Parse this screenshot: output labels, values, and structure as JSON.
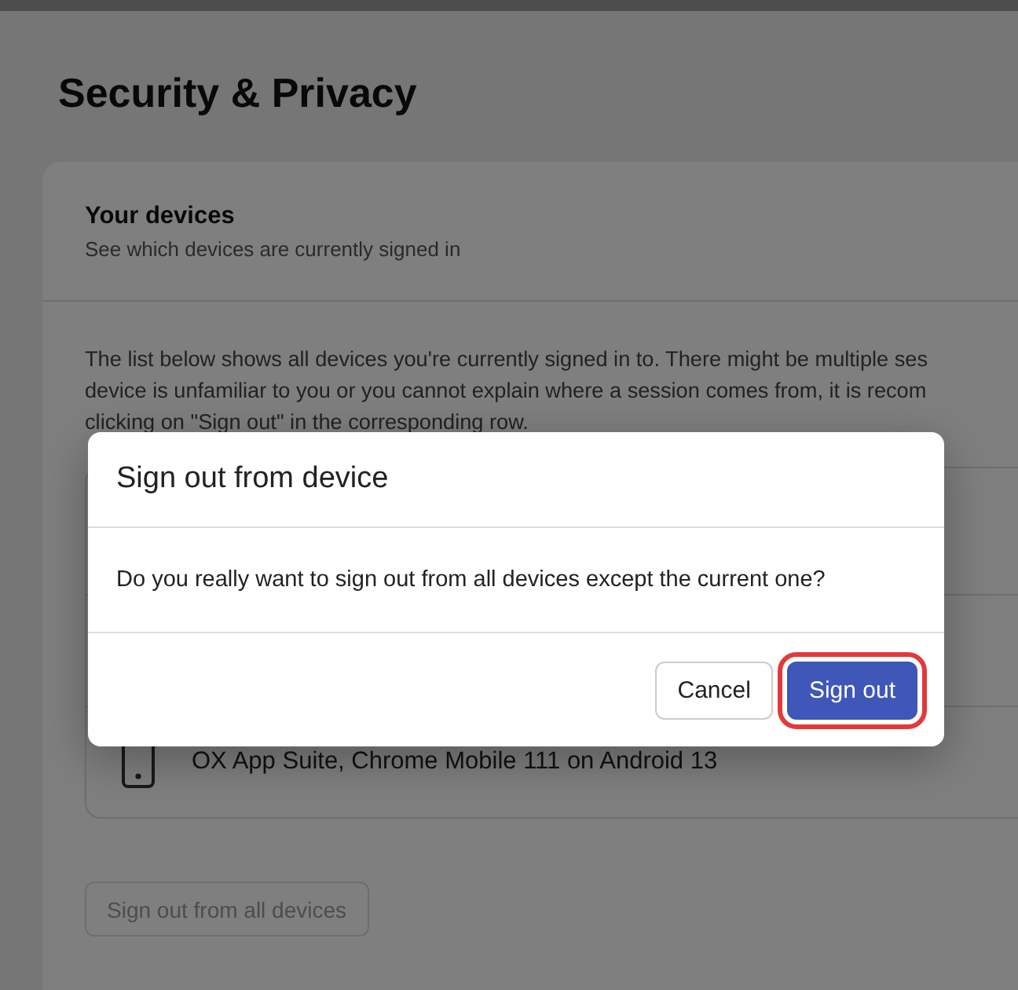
{
  "page": {
    "title": "Security & Privacy"
  },
  "devices_card": {
    "heading": "Your devices",
    "subheading": "See which devices are currently signed in",
    "description_lines": [
      "The list below shows all devices you're currently signed in to. There might be multiple ses",
      "device is unfamiliar to you or you cannot explain where a session comes from, it is recom",
      "clicking on \"Sign out\" in the corresponding row."
    ],
    "devices": [
      {
        "kind": "phone",
        "name": "OX App Suite, Chrome Mobile 111 on Android 13"
      }
    ],
    "sign_out_all_button": {
      "label": "Sign out from all devices",
      "disabled": true
    }
  },
  "dialog": {
    "title": "Sign out from device",
    "message": "Do you really want to sign out from all devices except the current one?",
    "buttons": [
      {
        "label": "Cancel",
        "kind": "secondary",
        "highlighted": false
      },
      {
        "label": "Sign out",
        "kind": "primary",
        "highlighted": true
      }
    ]
  }
}
